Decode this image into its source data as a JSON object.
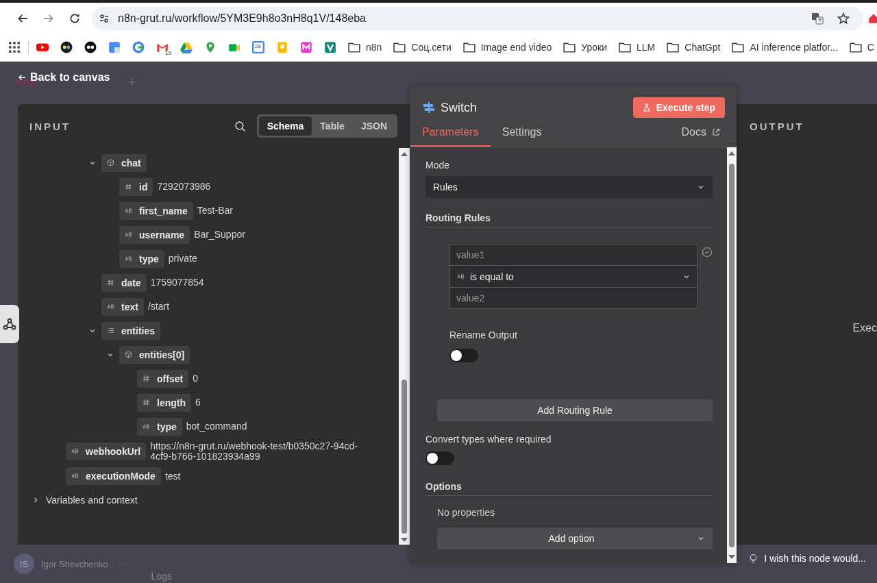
{
  "browser": {
    "url": "n8n-grut.ru/workflow/5YM3E9h8o3nH8q1V/148eba",
    "favicons": [
      {
        "kind": "video"
      },
      {
        "kind": "ok"
      },
      {
        "kind": "mask"
      },
      {
        "kind": "translate"
      },
      {
        "kind": "google"
      },
      {
        "kind": "mail",
        "text": "19"
      },
      {
        "kind": "drive"
      },
      {
        "kind": "maps"
      },
      {
        "kind": "meet"
      },
      {
        "kind": "calendar",
        "text": "28"
      },
      {
        "kind": "keep"
      },
      {
        "kind": "mira"
      },
      {
        "kind": "vpn"
      }
    ],
    "folders": [
      "n8n",
      "Соц.сети",
      "Image end video",
      "Уроки",
      "LLM",
      "ChatGpt",
      "AI inference platfor...",
      "C"
    ]
  },
  "topbar": {
    "back": "Back to canvas"
  },
  "input": {
    "title": "INPUT",
    "views": [
      {
        "label": "Schema",
        "selected": true
      },
      {
        "label": "Table",
        "selected": false
      },
      {
        "label": "JSON",
        "selected": false
      }
    ],
    "tree": [
      {
        "kind": "continued",
        "children": [
          {
            "kind": "continued",
            "children": [
              {
                "kind": "object",
                "key": "chat",
                "expanded": true,
                "children": [
                  {
                    "kind": "number",
                    "key": "id",
                    "value": "7292073986"
                  },
                  {
                    "kind": "string",
                    "key": "first_name",
                    "value": "Test-Bar"
                  },
                  {
                    "kind": "string",
                    "key": "username",
                    "value": "Bar_Suppor"
                  },
                  {
                    "kind": "string",
                    "key": "type",
                    "value": "private"
                  }
                ]
              },
              {
                "kind": "number",
                "key": "date",
                "value": "1759077854"
              },
              {
                "kind": "string",
                "key": "text",
                "value": "/start"
              },
              {
                "kind": "array",
                "key": "entities",
                "expanded": true,
                "children": [
                  {
                    "kind": "object",
                    "key": "entities[0]",
                    "expanded": true,
                    "children": [
                      {
                        "kind": "number",
                        "key": "offset",
                        "value": "0"
                      },
                      {
                        "kind": "number",
                        "key": "length",
                        "value": "6"
                      },
                      {
                        "kind": "string",
                        "key": "type",
                        "value": "bot_command"
                      }
                    ]
                  }
                ]
              }
            ]
          }
        ]
      },
      {
        "kind": "string",
        "key": "webhookUrl",
        "value": "https://n8n-grut.ru/webhook-test/b0350c27-94cd-4cf9-b766-101823934a99"
      },
      {
        "kind": "string",
        "key": "executionMode",
        "value": "test"
      }
    ],
    "variables": {
      "label": "Variables and context",
      "expanded": false
    }
  },
  "node": {
    "title": "Switch",
    "execute": "Execute step",
    "tabs": [
      {
        "label": "Parameters",
        "selected": true
      },
      {
        "label": "Settings",
        "selected": false
      }
    ],
    "docs": "Docs",
    "mode": {
      "label": "Mode",
      "value": "Rules"
    },
    "routing": {
      "label": "Routing Rules",
      "value1_placeholder": "value1",
      "operator": "is equal to",
      "value2_placeholder": "value2",
      "rename_label": "Rename Output",
      "rename_on": false,
      "add": "Add Routing Rule"
    },
    "convert": {
      "label": "Convert types where required",
      "on": false
    },
    "options": {
      "label": "Options",
      "empty": "No properties",
      "add": "Add option"
    }
  },
  "output": {
    "title": "OUTPUT",
    "body": "Exec"
  },
  "footer": {
    "avatar": "IS",
    "user": "Igor Shevchenko",
    "more": "···",
    "logs": "Logs",
    "feedback": "I wish this node would..."
  }
}
